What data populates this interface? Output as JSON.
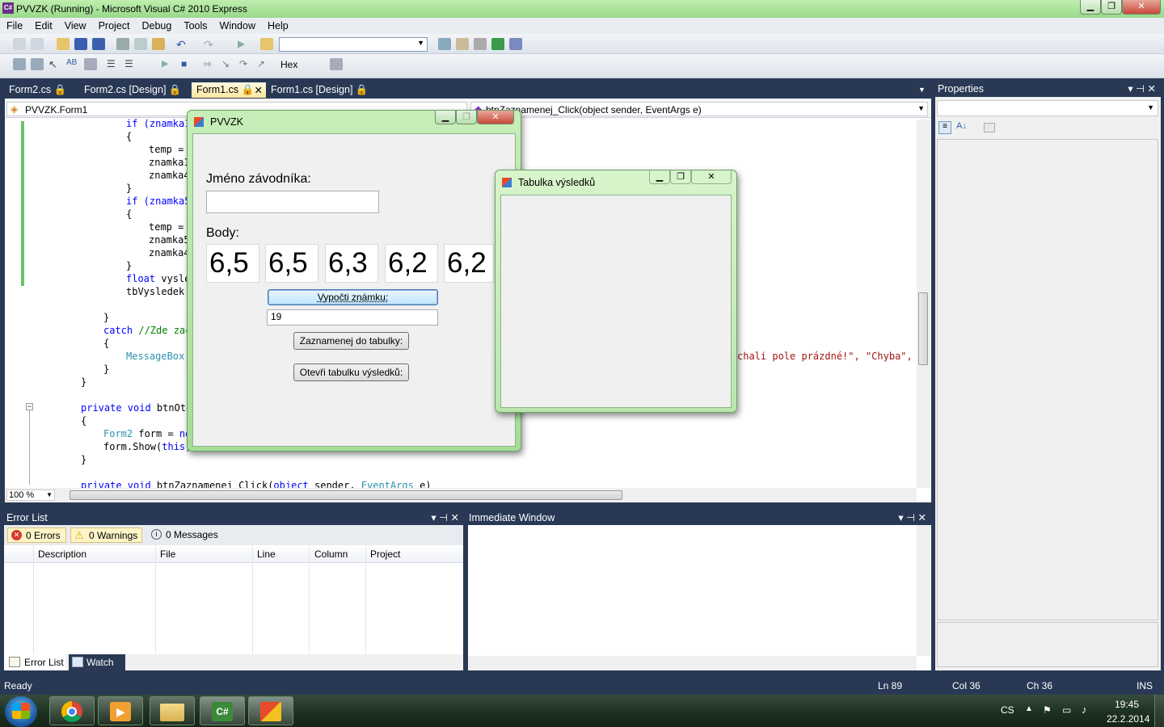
{
  "window": {
    "title": "PVVZK (Running) - Microsoft Visual C# 2010 Express",
    "app_icon": "C#"
  },
  "menu": [
    "File",
    "Edit",
    "View",
    "Project",
    "Debug",
    "Tools",
    "Window",
    "Help"
  ],
  "toolbar2": {
    "hex_label": "Hex"
  },
  "doc_tabs": [
    {
      "label": "Form2.cs 🔒",
      "active": false
    },
    {
      "label": "Form2.cs [Design] 🔒",
      "active": false
    },
    {
      "label": "Form1.cs 🔒",
      "active": true
    },
    {
      "label": "Form1.cs [Design] 🔒",
      "active": false
    }
  ],
  "editor": {
    "class_dropdown": "PVVZK.Form1",
    "member_dropdown": "btnZaznamenej_Click(object sender, EventArgs e)",
    "zoom": "100 %",
    "code_fragments": {
      "l1": "if (znamka1",
      "l2": "{",
      "l3": "temp =",
      "l4": "znamka1",
      "l5": "znamka4",
      "l6": "}",
      "l7": "if (znamka5",
      "l8": "{",
      "l9": "temp =",
      "l10": "znamka5",
      "l11": "znamka4",
      "l12": "}",
      "l13a": "float",
      "l13b": " vysle",
      "l14": "tbVysledek.",
      "l15": "}",
      "l16a": "catch",
      "l16b": " //Zde zac",
      "l17": "{",
      "l18": "MessageBox.",
      "l18tail": "chali pole prázdné!\", \"Chyba\", M",
      "l19": "}",
      "l20": "}",
      "l21a": "private void",
      "l21b": " btnOte",
      "l22": "{",
      "l23a": "Form2",
      "l23b": " form = ",
      "l23c": "ne",
      "l24": "form.Show(",
      "l24b": "this",
      "l24c": ")",
      "l25": "}",
      "l26a": "private void",
      "l26b": " btnZaznamenej_Click(",
      "l26c": "object",
      "l26d": " sender, ",
      "l26e": "EventArgs",
      "l26f": " e)"
    }
  },
  "properties": {
    "title": "Properties"
  },
  "error_list": {
    "title": "Error List",
    "errors": "0 Errors",
    "warnings": "0 Warnings",
    "messages": "0 Messages",
    "columns": [
      "Description",
      "File",
      "Line",
      "Column",
      "Project"
    ]
  },
  "immediate": {
    "title": "Immediate Window"
  },
  "bottom_tabs": [
    "Error List",
    "Watch"
  ],
  "status": {
    "ready": "Ready",
    "ln": "Ln 89",
    "col": "Col 36",
    "ch": "Ch 36",
    "ins": "INS"
  },
  "form1": {
    "title": "PVVZK",
    "name_label": "Jméno závodníka:",
    "name_value": "",
    "points_label": "Body:",
    "scores": [
      "6,5",
      "6,5",
      "6,3",
      "6,2",
      "6,2"
    ],
    "calc_button": "Vypočti známku:",
    "result_value": "19",
    "save_button": "Zaznamenej do tabulky:",
    "open_button": "Otevři tabulku výsledků:"
  },
  "form2": {
    "title": "Tabulka výsledků"
  },
  "taskbar": {
    "lang": "CS",
    "time": "19:45",
    "date": "22.2.2014"
  },
  "colors": {
    "titlebar": "#a8e39a",
    "ide_background": "#293955",
    "active_tab": "#fde7a0",
    "keyword": "#0000ff",
    "type": "#2b91af",
    "string": "#a31515"
  }
}
